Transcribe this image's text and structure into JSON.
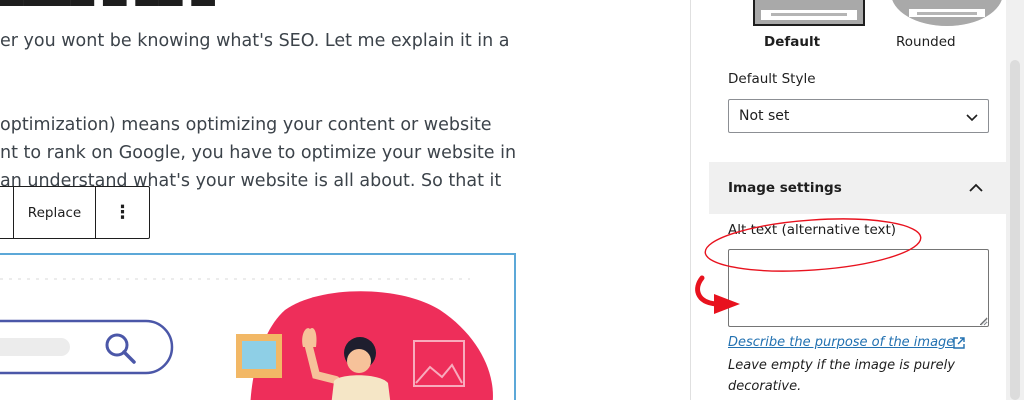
{
  "editor": {
    "paragraph1": "er you wont be knowing what's SEO. Let me explain it in a",
    "paragraph2_lines": [
      "optimization) means optimizing your content or website",
      "nt to rank on Google, you have to optimize your website in",
      "an understand what's your website is all about. So that it"
    ],
    "toolbar": {
      "replace_label": "Replace",
      "more_label": "⋮"
    }
  },
  "sidebar": {
    "styles": {
      "default_label": "Default",
      "rounded_label": "Rounded",
      "selected": "Default"
    },
    "default_style": {
      "label": "Default Style",
      "value": "Not set"
    },
    "image_settings": {
      "title": "Image settings",
      "alt_label": "Alt text (alternative text)",
      "alt_value": "",
      "help_link": "Describe the purpose of the image",
      "help_text": "Leave empty if the image is purely decorative."
    }
  },
  "colors": {
    "accent_link": "#2271b1",
    "annotation_red": "#e8121e",
    "image_block_border": "#5ca8d8",
    "illustration_pink": "#ee2e5a"
  },
  "icons": [
    "chevron-down-icon",
    "chevron-up-icon",
    "external-link-icon",
    "search-icon",
    "more-options-icon"
  ]
}
